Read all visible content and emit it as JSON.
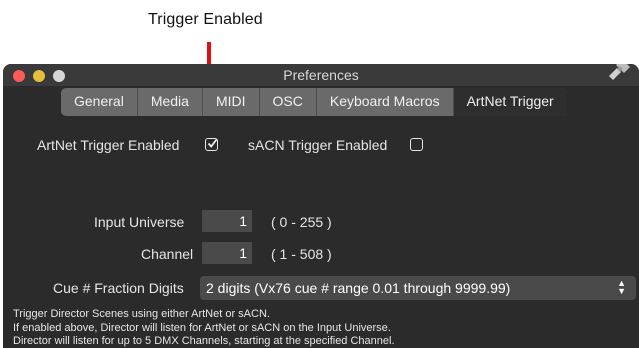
{
  "annotation": {
    "label": "Trigger Enabled"
  },
  "window": {
    "title": "Preferences"
  },
  "tabs": [
    {
      "label": "General",
      "active": false
    },
    {
      "label": "Media",
      "active": false
    },
    {
      "label": "MIDI",
      "active": false
    },
    {
      "label": "OSC",
      "active": false
    },
    {
      "label": "Keyboard Macros",
      "active": false
    },
    {
      "label": "ArtNet Trigger",
      "active": true
    }
  ],
  "artnet": {
    "label": "ArtNet Trigger Enabled",
    "checked": true
  },
  "sacn": {
    "label": "sACN Trigger Enabled",
    "checked": false
  },
  "input_universe": {
    "label": "Input Universe",
    "value": "1",
    "range": "( 0 - 255 )"
  },
  "channel": {
    "label": "Channel",
    "value": "1",
    "range": "( 1 - 508 )"
  },
  "cue_fraction": {
    "label": "Cue # Fraction Digits",
    "selected": "2 digits (Vx76 cue # range 0.01 through 9999.99)"
  },
  "description": {
    "line1": "Trigger Director Scenes using either ArtNet or sACN.",
    "line2": "If enabled above, Director will listen for ArtNet or sACN on the Input Universe.",
    "line3": "Director will listen for up to 5 DMX Channels, starting at the specified Channel."
  },
  "colors": {
    "annotation_line": "#e01010",
    "window_bg": "#2b2b2b",
    "close": "#fc5b57",
    "minimize": "#e5bf3c",
    "zoom": "#d6d6d6"
  }
}
